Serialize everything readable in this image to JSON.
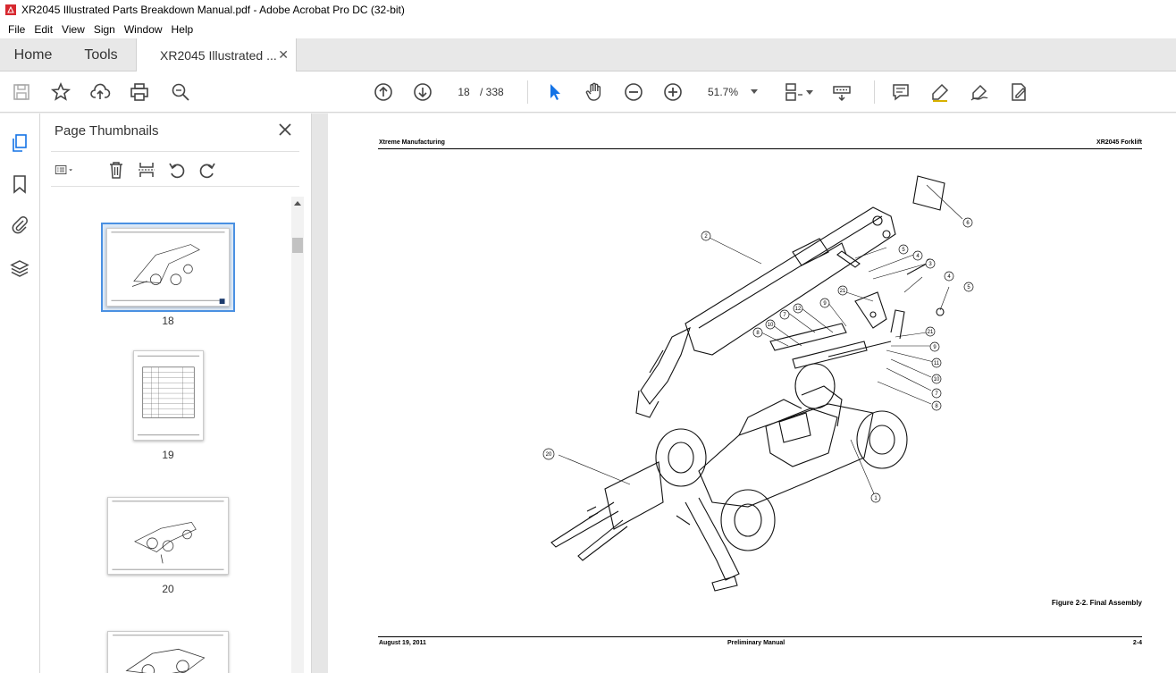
{
  "window": {
    "title": "XR2045 Illustrated Parts Breakdown Manual.pdf - Adobe Acrobat Pro DC (32-bit)"
  },
  "menu": [
    "File",
    "Edit",
    "View",
    "Sign",
    "Window",
    "Help"
  ],
  "tabs": {
    "home": "Home",
    "tools": "Tools",
    "document": "XR2045 Illustrated ..."
  },
  "toolbar": {
    "current_page": "18",
    "total_pages": "/ 338",
    "zoom": "51.7%"
  },
  "thumbnails_panel": {
    "title": "Page Thumbnails",
    "pages": [
      {
        "label": "18",
        "selected": true
      },
      {
        "label": "19",
        "selected": false
      },
      {
        "label": "20",
        "selected": false
      }
    ]
  },
  "document_page": {
    "header_left": "Xtreme Manufacturing",
    "header_right": "XR2045 Forklift",
    "caption": "Figure 2-2.  Final Assembly",
    "footer_left": "August 19, 2011",
    "footer_center": "Preliminary Manual",
    "footer_right": "2-4",
    "callouts": [
      "1",
      "2",
      "3",
      "4",
      "4",
      "5",
      "5",
      "6",
      "7",
      "7",
      "8",
      "8",
      "9",
      "9",
      "10",
      "10",
      "11",
      "12",
      "20",
      "21",
      "21"
    ]
  },
  "colors": {
    "accent": "#4a90e2",
    "pdf_red": "#d7282f",
    "select_cursor": "#1473e6"
  }
}
